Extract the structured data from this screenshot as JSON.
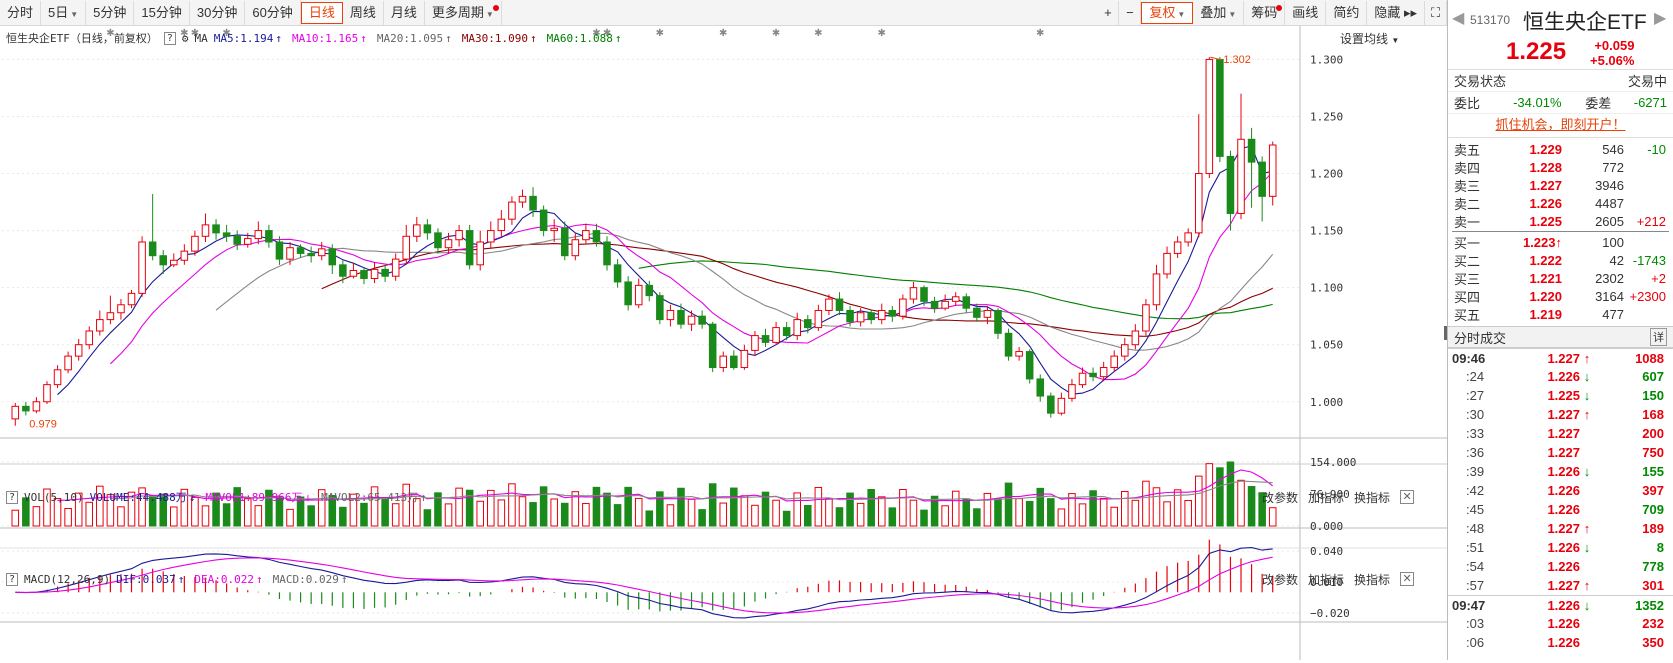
{
  "toolbar": {
    "periods": [
      {
        "label": "分时",
        "active": false,
        "caret": false,
        "dot": false
      },
      {
        "label": "5日",
        "active": false,
        "caret": true,
        "dot": false
      },
      {
        "label": "5分钟",
        "active": false,
        "caret": false,
        "dot": false
      },
      {
        "label": "15分钟",
        "active": false,
        "caret": false,
        "dot": false
      },
      {
        "label": "30分钟",
        "active": false,
        "caret": false,
        "dot": false
      },
      {
        "label": "60分钟",
        "active": false,
        "caret": false,
        "dot": false
      },
      {
        "label": "日线",
        "active": true,
        "caret": false,
        "dot": false
      },
      {
        "label": "周线",
        "active": false,
        "caret": false,
        "dot": false
      },
      {
        "label": "月线",
        "active": false,
        "caret": false,
        "dot": false
      },
      {
        "label": "更多周期",
        "active": false,
        "caret": true,
        "dot": true
      }
    ],
    "right": [
      {
        "label": "+",
        "kind": "icon"
      },
      {
        "label": "−",
        "kind": "icon"
      },
      {
        "label": "复权",
        "kind": "fuquan",
        "caret": true
      },
      {
        "label": "叠加",
        "kind": "normal",
        "caret": true
      },
      {
        "label": "筹码",
        "kind": "normal",
        "dot": true
      },
      {
        "label": "画线",
        "kind": "normal"
      },
      {
        "label": "简约",
        "kind": "normal"
      },
      {
        "label": "隐藏 ▸▸",
        "kind": "normal"
      },
      {
        "label": "⛶",
        "kind": "icon"
      }
    ]
  },
  "info": {
    "name": "恒生央企ETF（日线，前复权）",
    "ma_label": "MA",
    "items": [
      {
        "text": "MA5:1.194",
        "color": "#1a1a99",
        "arrow": "↑"
      },
      {
        "text": "MA10:1.165",
        "color": "#e600e6",
        "arrow": "↑"
      },
      {
        "text": "MA20:1.095",
        "color": "#666666",
        "arrow": "↑"
      },
      {
        "text": "MA30:1.090",
        "color": "#8b0000",
        "arrow": "↑"
      },
      {
        "text": "MA60:1.088",
        "color": "#008000",
        "arrow": "↑"
      }
    ],
    "settings": "设置均线"
  },
  "vol_title": {
    "label": "VOL(5,10)",
    "items": [
      {
        "text": "VOLUME:44.488万",
        "color": "#1a1a99",
        "arrow": "↓"
      },
      {
        "text": "MAVOL1:89.966万",
        "color": "#e600e6",
        "arrow": "↓"
      },
      {
        "text": "MAVOL2:65.413万",
        "color": "#666666",
        "arrow": "↑"
      }
    ]
  },
  "macd_title": {
    "label": "MACD(12,26,9)",
    "items": [
      {
        "text": "DIF:0.037",
        "color": "#1a1a99",
        "arrow": "↑"
      },
      {
        "text": "DEA:0.022",
        "color": "#e600e6",
        "arrow": "↑"
      },
      {
        "text": "MACD:0.029",
        "color": "#666666",
        "arrow": "↑"
      }
    ]
  },
  "panel_actions": [
    "改参数",
    "加指标",
    "换指标"
  ],
  "axes": {
    "price": [
      "1.300",
      "1.250",
      "1.200",
      "1.150",
      "1.100",
      "1.050",
      "1.000"
    ],
    "vol": [
      "154.000",
      "76.900",
      "0.000"
    ],
    "macd": [
      "0.040",
      "0.010",
      "−0.020"
    ],
    "high_label": "1.302",
    "low_label": "0.979"
  },
  "sidebar": {
    "code": "513170",
    "name": "恒生央企ETF",
    "price": "1.225",
    "change": "+0.059",
    "change_pct": "+5.06%",
    "status_label": "交易状态",
    "status_value": "交易中",
    "weibi_label": "委比",
    "weibi_value": "-34.01%",
    "weicha_label": "委差",
    "weicha_value": "-6271",
    "promo": "抓住机会，即刻开户！",
    "asks": [
      {
        "label": "卖五",
        "price": "1.229",
        "vol": "546",
        "chg": "-10",
        "arrow": ""
      },
      {
        "label": "卖四",
        "price": "1.228",
        "vol": "772",
        "chg": "",
        "arrow": ""
      },
      {
        "label": "卖三",
        "price": "1.227",
        "vol": "3946",
        "chg": "",
        "arrow": ""
      },
      {
        "label": "卖二",
        "price": "1.226",
        "vol": "4487",
        "chg": "",
        "arrow": ""
      },
      {
        "label": "卖一",
        "price": "1.225",
        "vol": "2605",
        "chg": "+212",
        "arrow": ""
      }
    ],
    "bids": [
      {
        "label": "买一",
        "price": "1.223",
        "vol": "100",
        "chg": "",
        "arrow": "↑"
      },
      {
        "label": "买二",
        "price": "1.222",
        "vol": "42",
        "chg": "-1743",
        "arrow": ""
      },
      {
        "label": "买三",
        "price": "1.221",
        "vol": "2302",
        "chg": "+2",
        "arrow": ""
      },
      {
        "label": "买四",
        "price": "1.220",
        "vol": "3164",
        "chg": "+2300",
        "arrow": ""
      },
      {
        "label": "买五",
        "price": "1.219",
        "vol": "477",
        "chg": "",
        "arrow": ""
      }
    ],
    "ticks_title": "分时成交",
    "ticks_icon": "详",
    "ticks": [
      {
        "t": "09:46",
        "p": "1.227",
        "a": "↑",
        "v": "1088",
        "vc": "red",
        "bold": true
      },
      {
        "t": ":24",
        "p": "1.226",
        "a": "↓",
        "v": "607",
        "vc": "green"
      },
      {
        "t": ":27",
        "p": "1.225",
        "a": "↓",
        "v": "150",
        "vc": "green"
      },
      {
        "t": ":30",
        "p": "1.227",
        "a": "↑",
        "v": "168",
        "vc": "red"
      },
      {
        "t": ":33",
        "p": "1.227",
        "a": "",
        "v": "200",
        "vc": "red"
      },
      {
        "t": ":36",
        "p": "1.227",
        "a": "",
        "v": "750",
        "vc": "red"
      },
      {
        "t": ":39",
        "p": "1.226",
        "a": "↓",
        "v": "155",
        "vc": "green"
      },
      {
        "t": ":42",
        "p": "1.226",
        "a": "",
        "v": "397",
        "vc": "red"
      },
      {
        "t": ":45",
        "p": "1.226",
        "a": "",
        "v": "709",
        "vc": "green"
      },
      {
        "t": ":48",
        "p": "1.227",
        "a": "↑",
        "v": "189",
        "vc": "red"
      },
      {
        "t": ":51",
        "p": "1.226",
        "a": "↓",
        "v": "8",
        "vc": "green"
      },
      {
        "t": ":54",
        "p": "1.226",
        "a": "",
        "v": "778",
        "vc": "green"
      },
      {
        "t": ":57",
        "p": "1.227",
        "a": "↑",
        "v": "301",
        "vc": "red"
      },
      {
        "t": "09:47",
        "p": "1.226",
        "a": "↓",
        "v": "1352",
        "vc": "green",
        "bold": true
      },
      {
        "t": ":03",
        "p": "1.226",
        "a": "",
        "v": "232",
        "vc": "red"
      },
      {
        "t": ":06",
        "p": "1.226",
        "a": "",
        "v": "350",
        "vc": "red"
      }
    ]
  },
  "chart_data": {
    "type": "candlestick",
    "candles": [
      [
        0.985,
        0.996,
        0.979,
        0.999
      ],
      [
        0.996,
        0.992,
        0.988,
        1.0
      ],
      [
        0.992,
        1.0,
        0.99,
        1.004
      ],
      [
        1.0,
        1.015,
        0.998,
        1.018
      ],
      [
        1.015,
        1.028,
        1.012,
        1.032
      ],
      [
        1.028,
        1.04,
        1.025,
        1.044
      ],
      [
        1.04,
        1.05,
        1.036,
        1.055
      ],
      [
        1.05,
        1.062,
        1.046,
        1.066
      ],
      [
        1.062,
        1.072,
        1.058,
        1.08
      ],
      [
        1.072,
        1.078,
        1.068,
        1.093
      ],
      [
        1.078,
        1.085,
        1.072,
        1.09
      ],
      [
        1.085,
        1.095,
        1.082,
        1.098
      ],
      [
        1.095,
        1.14,
        1.092,
        1.145
      ],
      [
        1.14,
        1.128,
        1.124,
        1.182
      ],
      [
        1.128,
        1.12,
        1.112,
        1.133
      ],
      [
        1.12,
        1.124,
        1.118,
        1.13
      ],
      [
        1.124,
        1.132,
        1.12,
        1.138
      ],
      [
        1.132,
        1.145,
        1.128,
        1.15
      ],
      [
        1.145,
        1.155,
        1.14,
        1.165
      ],
      [
        1.155,
        1.148,
        1.142,
        1.16
      ],
      [
        1.148,
        1.145,
        1.14,
        1.155
      ],
      [
        1.145,
        1.138,
        1.133,
        1.15
      ],
      [
        1.138,
        1.143,
        1.135,
        1.148
      ],
      [
        1.143,
        1.15,
        1.138,
        1.158
      ],
      [
        1.15,
        1.14,
        1.135,
        1.155
      ],
      [
        1.14,
        1.125,
        1.12,
        1.145
      ],
      [
        1.125,
        1.135,
        1.12,
        1.14
      ],
      [
        1.135,
        1.13,
        1.126,
        1.138
      ],
      [
        1.13,
        1.128,
        1.122,
        1.136
      ],
      [
        1.128,
        1.134,
        1.124,
        1.14
      ],
      [
        1.134,
        1.12,
        1.112,
        1.138
      ],
      [
        1.12,
        1.11,
        1.104,
        1.124
      ],
      [
        1.11,
        1.115,
        1.108,
        1.122
      ],
      [
        1.115,
        1.108,
        1.103,
        1.118
      ],
      [
        1.108,
        1.116,
        1.104,
        1.122
      ],
      [
        1.116,
        1.11,
        1.105,
        1.12
      ],
      [
        1.11,
        1.125,
        1.106,
        1.13
      ],
      [
        1.125,
        1.145,
        1.12,
        1.155
      ],
      [
        1.145,
        1.155,
        1.14,
        1.162
      ],
      [
        1.155,
        1.148,
        1.142,
        1.16
      ],
      [
        1.148,
        1.135,
        1.13,
        1.152
      ],
      [
        1.135,
        1.142,
        1.13,
        1.148
      ],
      [
        1.142,
        1.15,
        1.136,
        1.155
      ],
      [
        1.15,
        1.12,
        1.116,
        1.155
      ],
      [
        1.12,
        1.14,
        1.115,
        1.15
      ],
      [
        1.14,
        1.15,
        1.135,
        1.158
      ],
      [
        1.15,
        1.16,
        1.145,
        1.168
      ],
      [
        1.16,
        1.175,
        1.155,
        1.18
      ],
      [
        1.175,
        1.18,
        1.17,
        1.186
      ],
      [
        1.18,
        1.168,
        1.162,
        1.188
      ],
      [
        1.168,
        1.15,
        1.145,
        1.172
      ],
      [
        1.15,
        1.152,
        1.14,
        1.16
      ],
      [
        1.152,
        1.128,
        1.124,
        1.158
      ],
      [
        1.128,
        1.142,
        1.124,
        1.148
      ],
      [
        1.142,
        1.15,
        1.138,
        1.156
      ],
      [
        1.15,
        1.14,
        1.136,
        1.156
      ],
      [
        1.14,
        1.12,
        1.115,
        1.145
      ],
      [
        1.12,
        1.105,
        1.1,
        1.125
      ],
      [
        1.105,
        1.085,
        1.08,
        1.11
      ],
      [
        1.085,
        1.102,
        1.082,
        1.108
      ],
      [
        1.102,
        1.093,
        1.088,
        1.106
      ],
      [
        1.093,
        1.072,
        1.068,
        1.096
      ],
      [
        1.072,
        1.08,
        1.066,
        1.085
      ],
      [
        1.08,
        1.068,
        1.064,
        1.086
      ],
      [
        1.068,
        1.075,
        1.062,
        1.08
      ],
      [
        1.075,
        1.068,
        1.064,
        1.08
      ],
      [
        1.068,
        1.03,
        1.026,
        1.07
      ],
      [
        1.03,
        1.04,
        1.026,
        1.044
      ],
      [
        1.04,
        1.03,
        1.028,
        1.045
      ],
      [
        1.03,
        1.045,
        1.028,
        1.05
      ],
      [
        1.045,
        1.058,
        1.04,
        1.062
      ],
      [
        1.058,
        1.052,
        1.048,
        1.064
      ],
      [
        1.052,
        1.065,
        1.05,
        1.07
      ],
      [
        1.065,
        1.058,
        1.054,
        1.07
      ],
      [
        1.058,
        1.072,
        1.054,
        1.078
      ],
      [
        1.072,
        1.065,
        1.06,
        1.076
      ],
      [
        1.065,
        1.08,
        1.062,
        1.085
      ],
      [
        1.08,
        1.09,
        1.076,
        1.094
      ],
      [
        1.09,
        1.08,
        1.076,
        1.096
      ],
      [
        1.08,
        1.07,
        1.066,
        1.084
      ],
      [
        1.07,
        1.078,
        1.066,
        1.082
      ],
      [
        1.078,
        1.072,
        1.068,
        1.08
      ],
      [
        1.072,
        1.08,
        1.068,
        1.086
      ],
      [
        1.08,
        1.075,
        1.07,
        1.084
      ],
      [
        1.075,
        1.09,
        1.072,
        1.094
      ],
      [
        1.09,
        1.1,
        1.086,
        1.105
      ],
      [
        1.1,
        1.088,
        1.084,
        1.102
      ],
      [
        1.088,
        1.082,
        1.078,
        1.092
      ],
      [
        1.082,
        1.088,
        1.08,
        1.094
      ],
      [
        1.088,
        1.092,
        1.084,
        1.096
      ],
      [
        1.092,
        1.082,
        1.078,
        1.095
      ],
      [
        1.082,
        1.074,
        1.07,
        1.086
      ],
      [
        1.074,
        1.08,
        1.068,
        1.084
      ],
      [
        1.08,
        1.06,
        1.055,
        1.082
      ],
      [
        1.06,
        1.04,
        1.036,
        1.064
      ],
      [
        1.04,
        1.044,
        1.036,
        1.048
      ],
      [
        1.044,
        1.02,
        1.016,
        1.046
      ],
      [
        1.02,
        1.005,
        1.0,
        1.024
      ],
      [
        1.005,
        0.99,
        0.986,
        1.008
      ],
      [
        0.99,
        1.003,
        0.988,
        1.008
      ],
      [
        1.003,
        1.015,
        1.0,
        1.02
      ],
      [
        1.015,
        1.025,
        1.012,
        1.03
      ],
      [
        1.025,
        1.022,
        1.018,
        1.03
      ],
      [
        1.022,
        1.03,
        1.018,
        1.035
      ],
      [
        1.03,
        1.04,
        1.026,
        1.045
      ],
      [
        1.04,
        1.05,
        1.036,
        1.056
      ],
      [
        1.05,
        1.062,
        1.046,
        1.068
      ],
      [
        1.062,
        1.085,
        1.058,
        1.09
      ],
      [
        1.085,
        1.112,
        1.08,
        1.12
      ],
      [
        1.112,
        1.13,
        1.108,
        1.136
      ],
      [
        1.13,
        1.14,
        1.126,
        1.145
      ],
      [
        1.14,
        1.148,
        1.136,
        1.152
      ],
      [
        1.148,
        1.2,
        1.144,
        1.252
      ],
      [
        1.2,
        1.3,
        1.196,
        1.302
      ],
      [
        1.3,
        1.215,
        1.21,
        1.302
      ],
      [
        1.215,
        1.165,
        1.15,
        1.22
      ],
      [
        1.165,
        1.23,
        1.16,
        1.27
      ],
      [
        1.23,
        1.21,
        1.17,
        1.24
      ],
      [
        1.21,
        1.18,
        1.158,
        1.215
      ],
      [
        1.18,
        1.225,
        1.172,
        1.228
      ]
    ],
    "ylim": [
      0.97,
      1.31
    ]
  }
}
